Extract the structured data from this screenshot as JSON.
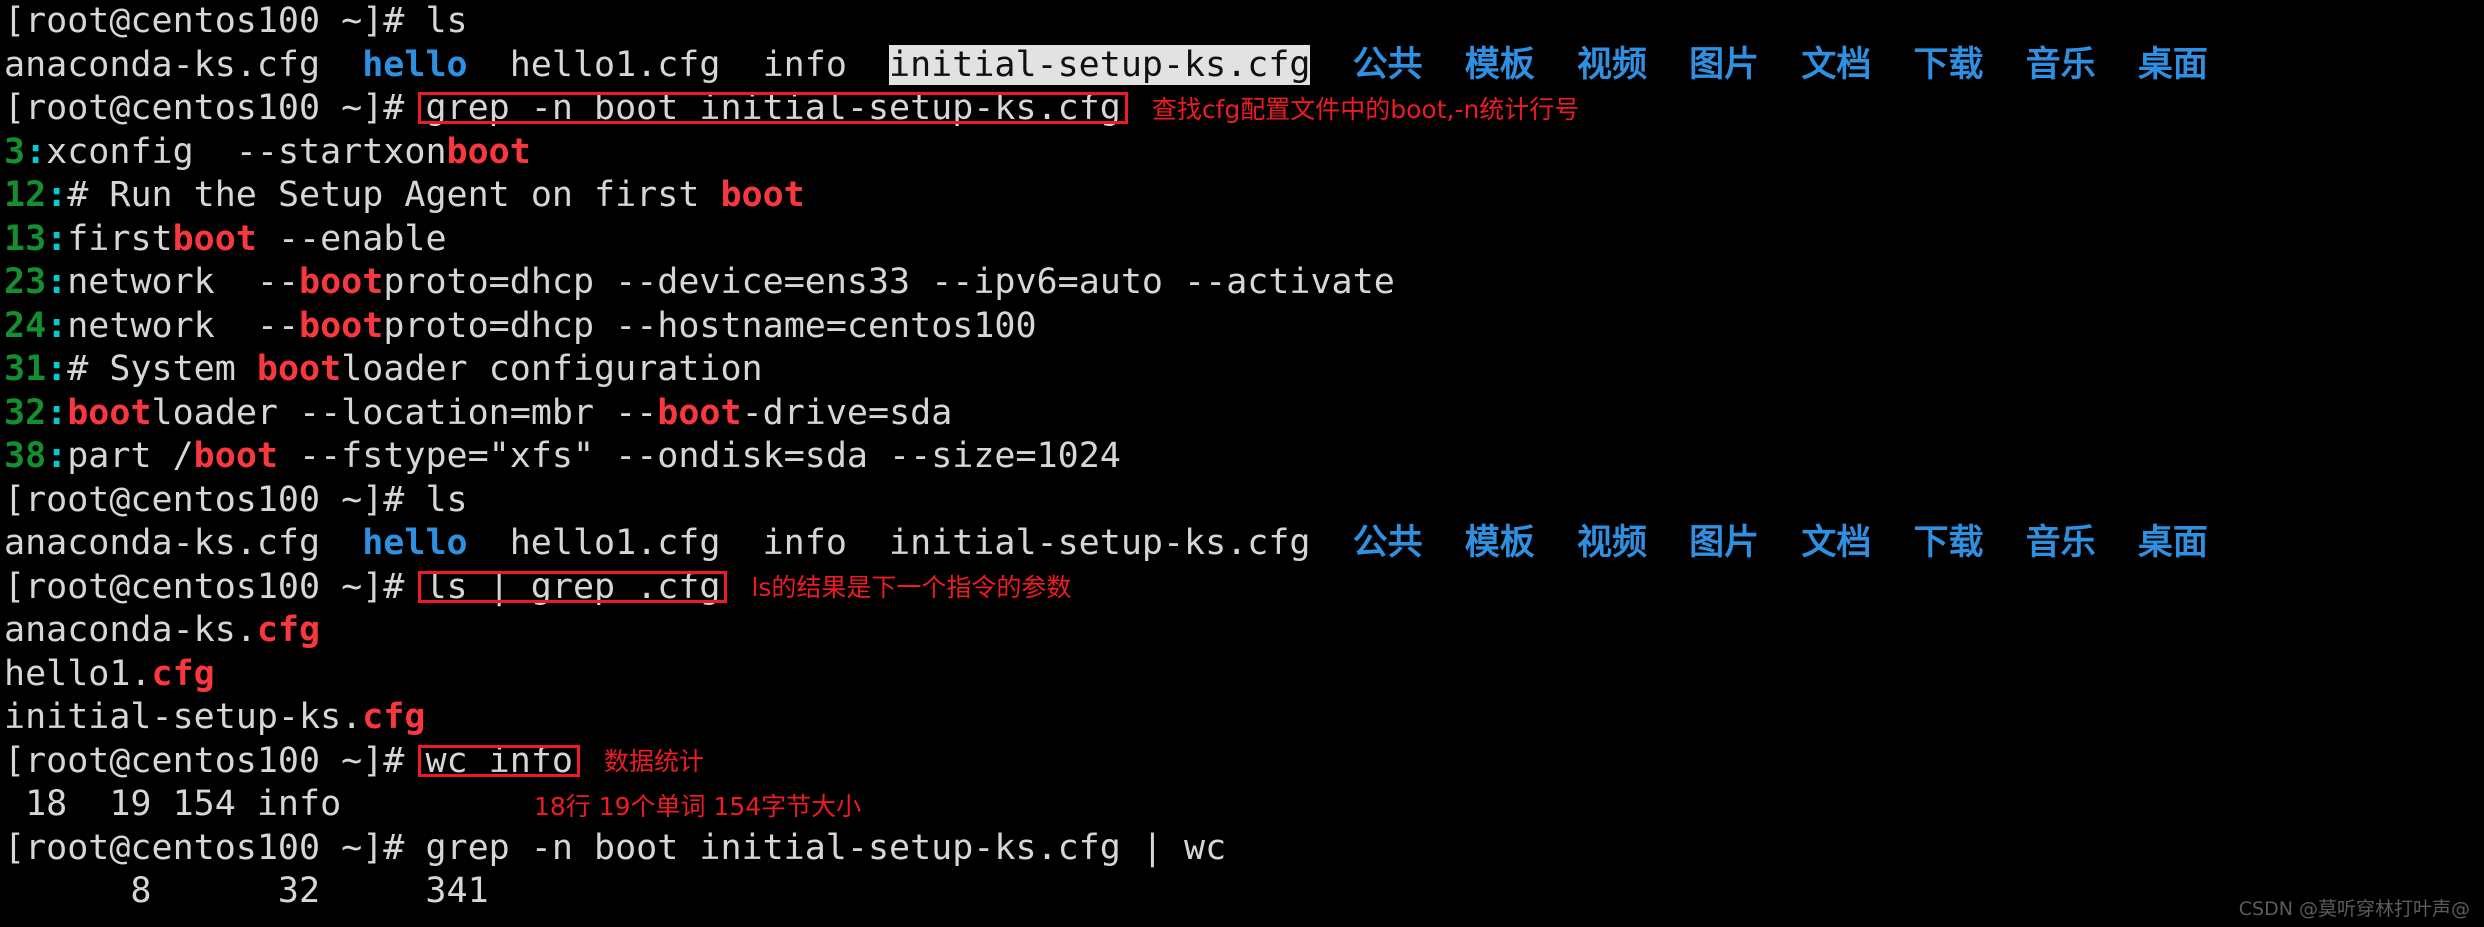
{
  "terminal": {
    "app": "CentOS Terminal",
    "prompt": "[root@centos100 ~]# ",
    "colors": {
      "background": "#000000",
      "foreground": "#d6d6d6",
      "directory_blue": "#2f8fe0",
      "match_red": "#f8373e",
      "line_number_green": "#138f2f",
      "separator_cyan": "#00cdcd",
      "annotation_red": "#ee1b24",
      "selection_bg": "#e2e2e2",
      "selection_fg": "#101010",
      "watermark": "#5c5c5c"
    },
    "lines": [
      {
        "id": "l01",
        "type": "command",
        "prompt": "[root@centos100 ~]# ",
        "command": "ls"
      },
      {
        "id": "l02",
        "type": "ls-output-1",
        "files_plain_1": "anaconda-ks.cfg  ",
        "file_hello": "hello",
        "files_plain_2": "  hello1.cfg  info  ",
        "file_selected": "initial-setup-ks.cfg",
        "dirs": [
          "公共",
          "模板",
          "视频",
          "图片",
          "文档",
          "下载",
          "音乐",
          "桌面"
        ]
      },
      {
        "id": "l03",
        "type": "command-boxed",
        "prompt": "[root@centos100 ~]# ",
        "command": "grep -n boot initial-setup-ks.cfg"
      },
      {
        "id": "l04",
        "type": "grep",
        "num": "3",
        "pre": "xconfig  --startxon",
        "match": "boot",
        "post": ""
      },
      {
        "id": "l05",
        "type": "grep",
        "num": "12",
        "pre": "# Run the Setup Agent on first ",
        "match": "boot",
        "post": ""
      },
      {
        "id": "l06",
        "type": "grep",
        "num": "13",
        "pre": "first",
        "match": "boot",
        "post": " --enable"
      },
      {
        "id": "l07",
        "type": "grep",
        "num": "23",
        "pre": "network  --",
        "match": "boot",
        "post": "proto=dhcp --device=ens33 --ipv6=auto --activate"
      },
      {
        "id": "l08",
        "type": "grep",
        "num": "24",
        "pre": "network  --",
        "match": "boot",
        "post": "proto=dhcp --hostname=centos100"
      },
      {
        "id": "l09",
        "type": "grep",
        "num": "31",
        "pre": "# System ",
        "match": "boot",
        "post": "loader configuration"
      },
      {
        "id": "l10",
        "type": "grep-2",
        "num": "32",
        "pre": "",
        "match1": "boot",
        "mid": "loader --location=mbr --",
        "match2": "boot",
        "post": "-drive=sda"
      },
      {
        "id": "l11",
        "type": "grep",
        "num": "38",
        "pre": "part /",
        "match": "boot",
        "post": " --fstype=\"xfs\" --ondisk=sda --size=1024"
      },
      {
        "id": "l12",
        "type": "command",
        "prompt": "[root@centos100 ~]# ",
        "command": "ls"
      },
      {
        "id": "l13",
        "type": "ls-output-2",
        "files_plain_1": "anaconda-ks.cfg  ",
        "file_hello": "hello",
        "files_plain_2": "  hello1.cfg  info  initial-setup-ks.cfg",
        "dirs": [
          "公共",
          "模板",
          "视频",
          "图片",
          "文档",
          "下载",
          "音乐",
          "桌面"
        ]
      },
      {
        "id": "l14",
        "type": "command-boxed",
        "prompt": "[root@centos100 ~]# ",
        "command": "ls | grep .cfg"
      },
      {
        "id": "l15",
        "type": "cfg-result",
        "base": "anaconda-ks.",
        "ext": "cfg"
      },
      {
        "id": "l16",
        "type": "cfg-result",
        "base": "hello1.",
        "ext": "cfg"
      },
      {
        "id": "l17",
        "type": "cfg-result",
        "base": "initial-setup-ks.",
        "ext": "cfg"
      },
      {
        "id": "l18",
        "type": "command-boxed",
        "prompt": "[root@centos100 ~]# ",
        "command": "wc info"
      },
      {
        "id": "l19",
        "type": "plain",
        "text": " 18  19 154 info"
      },
      {
        "id": "l20",
        "type": "command",
        "prompt": "[root@centos100 ~]# ",
        "command": "grep -n boot initial-setup-ks.cfg | wc"
      },
      {
        "id": "l21",
        "type": "plain",
        "text": "      8      32     341"
      }
    ],
    "annotations": [
      {
        "id": "a1",
        "text": "查找cfg配置文件中的boot,-n统计行号"
      },
      {
        "id": "a2",
        "text": "ls的结果是下一个指令的参数"
      },
      {
        "id": "a3",
        "text": "数据统计"
      },
      {
        "id": "a4",
        "text": "18行  19个单词  154字节大小"
      }
    ],
    "watermark": "CSDN @莫听穿林打叶声@"
  }
}
